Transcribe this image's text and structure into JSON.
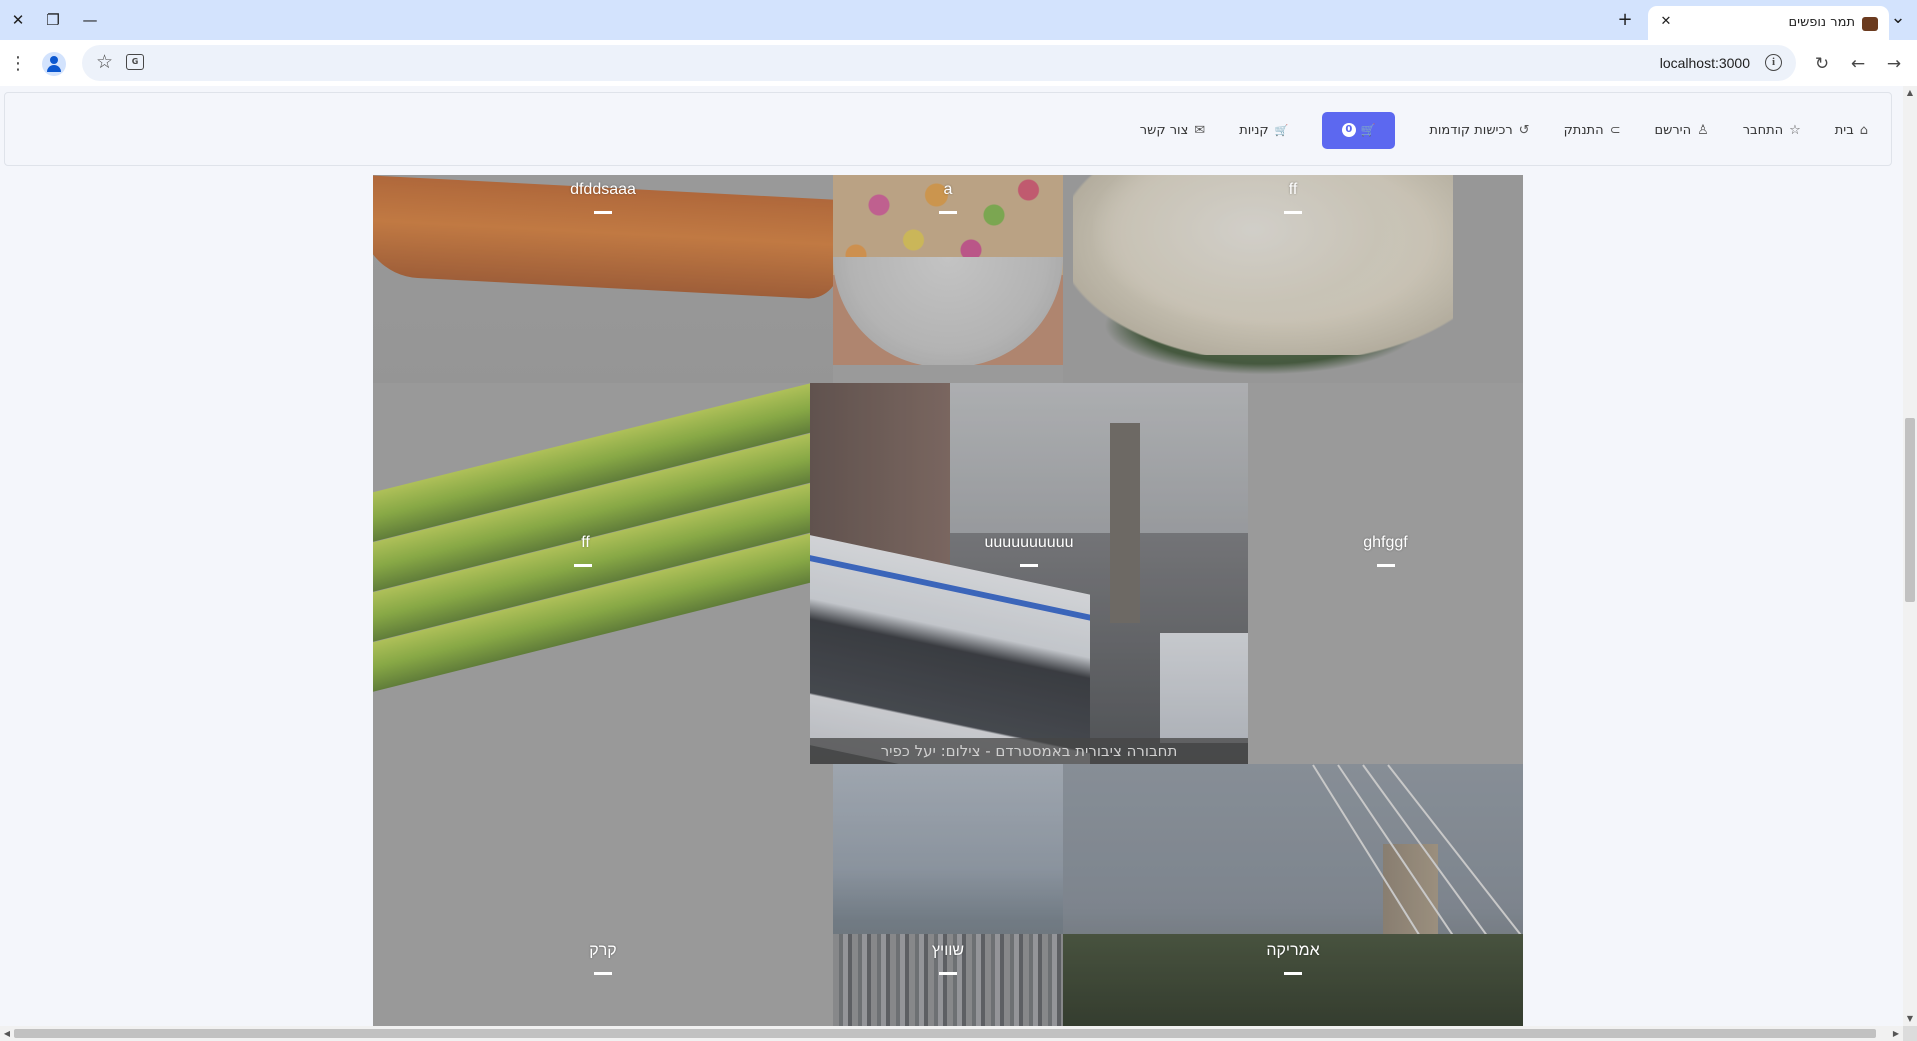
{
  "browser": {
    "tab_title": "תמר נופשים",
    "url": "localhost:3000",
    "controls": {
      "close": "✕",
      "restore": "❐",
      "minimize": "—",
      "new_tab": "+",
      "tab_menu": "⌄",
      "tab_close": "✕",
      "back": "←",
      "forward": "→",
      "reload": "↻",
      "menu": "⋮",
      "bookmark": "☆",
      "info": "i"
    }
  },
  "navbar": {
    "items": [
      {
        "label": "בית",
        "icon": "home-icon",
        "glyph": "⌂"
      },
      {
        "label": "התחבר",
        "icon": "star-icon",
        "glyph": "☆"
      },
      {
        "label": "הירשם",
        "icon": "user-icon",
        "glyph": "♙"
      },
      {
        "label": "התנתק",
        "icon": "unlock-icon",
        "glyph": "⊃"
      },
      {
        "label": "רכישות קודמות",
        "icon": "history-icon",
        "glyph": "↺"
      }
    ],
    "cart": {
      "icon": "cart-icon",
      "glyph": "🛒",
      "count": "0"
    },
    "items_after": [
      {
        "label": "קניות",
        "icon": "shop-icon",
        "glyph": "🛒"
      },
      {
        "label": "צור קשר",
        "icon": "mail-icon",
        "glyph": "✉"
      }
    ]
  },
  "grid": {
    "cells": [
      {
        "label": "dfddsaaa"
      },
      {
        "label": "a"
      },
      {
        "label": "ff"
      },
      {
        "label": "ff"
      },
      {
        "label": "uuuuuuuuuu",
        "caption": "תחבורה ציבורית באמסטרדם - צילום: יעל כפיר"
      },
      {
        "label": "ghfggf"
      },
      {
        "label": "קרק"
      },
      {
        "label": "שוויץ"
      },
      {
        "label": "אמריקה"
      }
    ]
  }
}
